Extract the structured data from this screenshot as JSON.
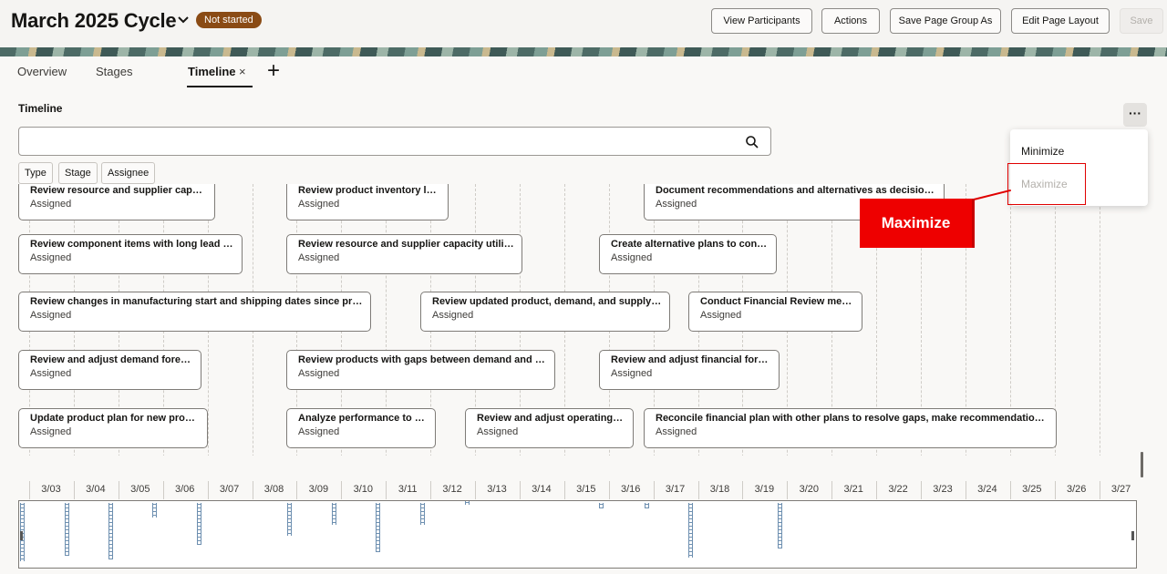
{
  "header": {
    "title": "March 2025 Cycle",
    "status_badge": "Not started",
    "buttons": [
      "View Participants",
      "Actions",
      "Save Page Group As",
      "Edit Page Layout",
      "Save"
    ]
  },
  "tabs": [
    {
      "label": "Overview"
    },
    {
      "label": "Stages"
    },
    {
      "label": "Timeline",
      "active": true,
      "close_glyph": "×"
    }
  ],
  "add_tab_glyph": "+",
  "section": {
    "title": "Timeline",
    "more_glyph": "···",
    "search_placeholder": "",
    "filters": [
      "Type",
      "Stage",
      "Assignee"
    ]
  },
  "tasks": [
    {
      "title": "Review resource and supplier capacities",
      "status": "Assigned"
    },
    {
      "title": "Review product inventory levels",
      "status": "Assigned"
    },
    {
      "title": "Document recommendations and alternatives as decision items",
      "status": "Assigned"
    },
    {
      "title": "Review component items with long lead times",
      "status": "Assigned"
    },
    {
      "title": "Review resource and supplier capacity utilization",
      "status": "Assigned"
    },
    {
      "title": "Create alternative plans to consider",
      "status": "Assigned"
    },
    {
      "title": "Review changes in manufacturing start and shipping dates since prior cycle",
      "status": "Assigned"
    },
    {
      "title": "Review updated product, demand, and supply plans",
      "status": "Assigned"
    },
    {
      "title": "Conduct Financial Review meeting",
      "status": "Assigned"
    },
    {
      "title": "Review and adjust demand forecasts",
      "status": "Assigned"
    },
    {
      "title": "Review products with gaps between demand and supply",
      "status": "Assigned"
    },
    {
      "title": "Review and adjust financial forecast",
      "status": "Assigned"
    },
    {
      "title": "Update product plan for new products",
      "status": "Assigned"
    },
    {
      "title": "Analyze performance to plan",
      "status": "Assigned"
    },
    {
      "title": "Review and adjust operating plan",
      "status": "Assigned"
    },
    {
      "title": "Reconcile financial plan with other plans to resolve gaps, make recommendations, and ...",
      "status": "Assigned"
    }
  ],
  "axis_dates": [
    "3/03",
    "3/04",
    "3/05",
    "3/06",
    "3/07",
    "3/08",
    "3/09",
    "3/10",
    "3/11",
    "3/12",
    "3/13",
    "3/14",
    "3/15",
    "3/16",
    "3/17",
    "3/18",
    "3/19",
    "3/20",
    "3/21",
    "3/22",
    "3/23",
    "3/24",
    "3/25",
    "3/26",
    "3/27"
  ],
  "menu": {
    "items": [
      {
        "label": "Minimize",
        "enabled": true
      },
      {
        "label": "Maximize",
        "enabled": false
      }
    ]
  },
  "callout": {
    "label": "Maximize"
  },
  "colors": {
    "badge": "#8a4b15",
    "callout": "#ee0000",
    "overview_marks": "#6d8fb0"
  }
}
